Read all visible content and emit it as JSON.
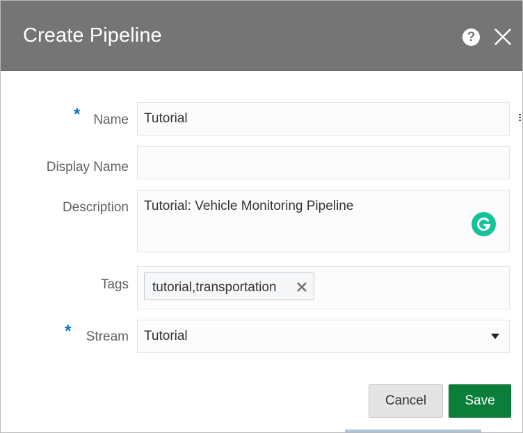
{
  "dialog": {
    "title": "Create Pipeline",
    "help_icon": "help-icon",
    "close_icon": "close-icon"
  },
  "form": {
    "name": {
      "label": "Name",
      "required": true,
      "required_mark": "*",
      "value": "Tutorial"
    },
    "display_name": {
      "label": "Display Name",
      "required": false,
      "value": ""
    },
    "description": {
      "label": "Description",
      "required": false,
      "value": "Tutorial: Vehicle Monitoring Pipeline"
    },
    "tags": {
      "label": "Tags",
      "items": [
        "tutorial,transportation"
      ],
      "remove_icon": "x-icon"
    },
    "stream": {
      "label": "Stream",
      "required": true,
      "required_mark": "*",
      "value": "Tutorial",
      "dropdown_icon": "caret-down-icon"
    }
  },
  "buttons": {
    "cancel": "Cancel",
    "save": "Save"
  },
  "colors": {
    "titlebar": "#757575",
    "required_mark": "#0572ce",
    "save_button": "#0b7f3a",
    "grammarly": "#15c39a"
  }
}
